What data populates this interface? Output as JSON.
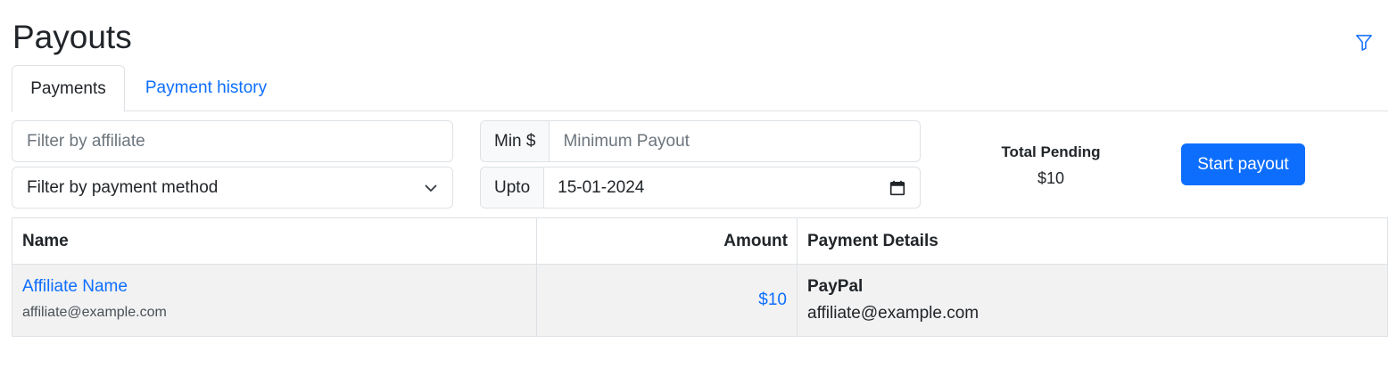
{
  "page": {
    "title": "Payouts"
  },
  "header": {
    "filter_icon": "filter-funnel-icon"
  },
  "tabs": [
    {
      "label": "Payments",
      "active": true
    },
    {
      "label": "Payment history",
      "active": false
    }
  ],
  "filters": {
    "affiliate": {
      "placeholder": "Filter by affiliate",
      "value": ""
    },
    "payment_method": {
      "selected": "Filter by payment method"
    },
    "min": {
      "addon": "Min $",
      "placeholder": "Minimum Payout",
      "value": ""
    },
    "upto": {
      "addon": "Upto",
      "value": "15-01-2024"
    }
  },
  "summary": {
    "total_label": "Total Pending",
    "total_value": "$10"
  },
  "actions": {
    "start_payout": "Start payout"
  },
  "table": {
    "headers": {
      "name": "Name",
      "amount": "Amount",
      "details": "Payment Details"
    },
    "rows": [
      {
        "name": "Affiliate Name",
        "email": "affiliate@example.com",
        "amount": "$10",
        "method": "PayPal",
        "method_detail": "affiliate@example.com"
      }
    ]
  },
  "colors": {
    "accent": "#0d6efd",
    "border": "#dee2e6",
    "row_bg": "#f2f2f2"
  }
}
